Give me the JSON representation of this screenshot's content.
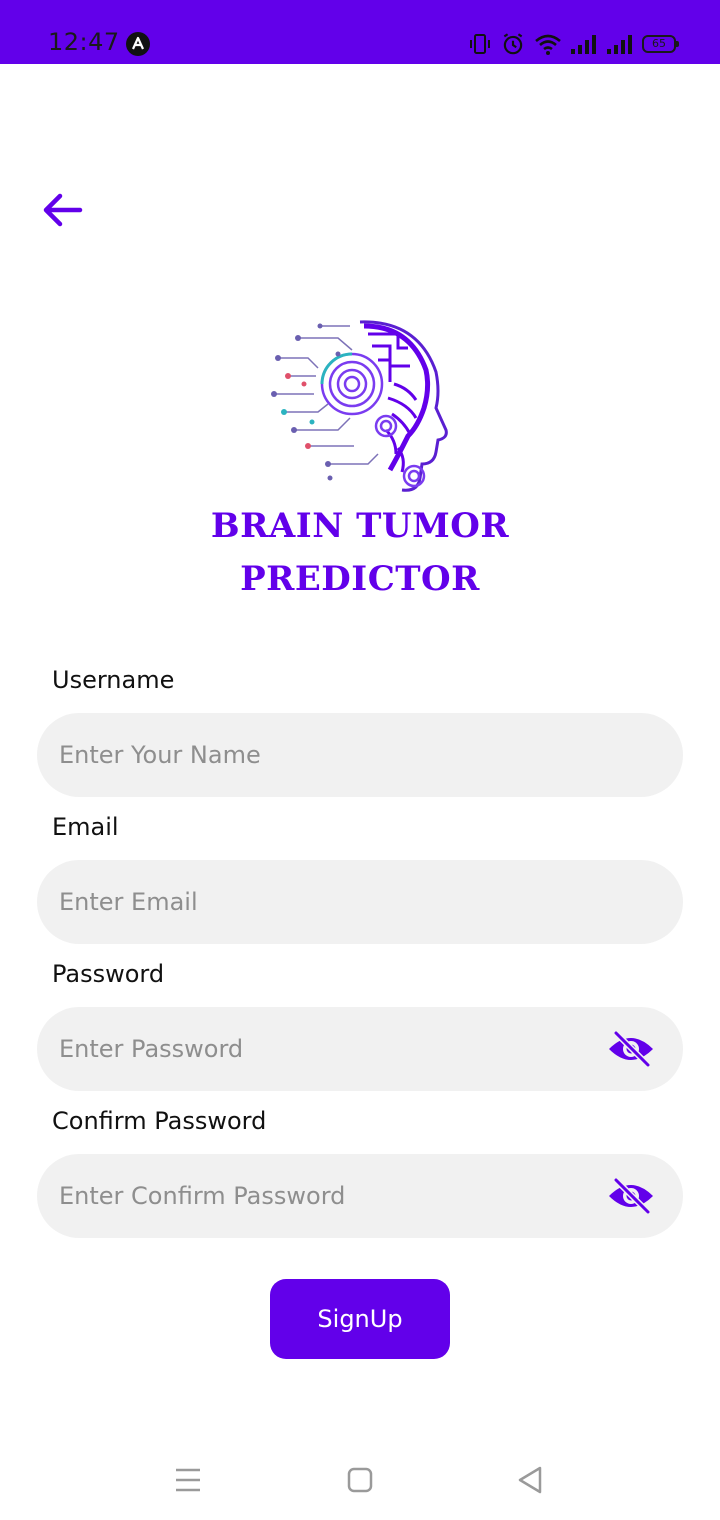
{
  "status_bar": {
    "time": "12:47",
    "battery": "65",
    "icons": [
      "app-notification-icon",
      "vibrate-icon",
      "alarm-icon",
      "wifi-icon",
      "signal-icon",
      "signal-icon",
      "battery-icon"
    ],
    "background": "#6200ea"
  },
  "header": {
    "back_icon": "arrow-left-icon"
  },
  "brand": {
    "logo_icon": "ai-brain-head-logo",
    "title_line1": "BRAIN TUMOR",
    "title_line2": "PREDICTOR"
  },
  "form": {
    "username": {
      "label": "Username",
      "placeholder": "Enter Your Name",
      "value": ""
    },
    "email": {
      "label": "Email",
      "placeholder": "Enter Email",
      "value": ""
    },
    "password": {
      "label": "Password",
      "placeholder": "Enter Password",
      "value": "",
      "toggle_icon": "eye-off-icon"
    },
    "confirm_password": {
      "label": "Confirm Password",
      "placeholder": "Enter Confirm Password",
      "value": "",
      "toggle_icon": "eye-off-icon"
    },
    "submit_label": "SignUp"
  },
  "nav_bar": {
    "icons": [
      "menu-icon",
      "home-square-icon",
      "back-triangle-icon"
    ]
  },
  "colors": {
    "accent": "#6200ea",
    "input_bg": "#f1f1f1",
    "placeholder": "#8e8e8e"
  }
}
